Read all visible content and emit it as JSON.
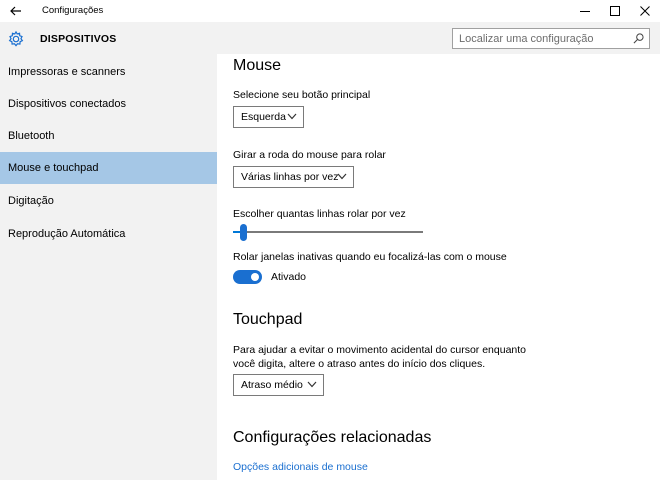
{
  "window": {
    "title": "Configurações"
  },
  "header": {
    "category": "DISPOSITIVOS",
    "search_placeholder": "Localizar uma configuração"
  },
  "sidebar": {
    "items": [
      {
        "label": "Impressoras e scanners",
        "selected": false
      },
      {
        "label": "Dispositivos conectados",
        "selected": false
      },
      {
        "label": "Bluetooth",
        "selected": false
      },
      {
        "label": "Mouse e touchpad",
        "selected": true
      },
      {
        "label": "Digitação",
        "selected": false
      },
      {
        "label": "Reprodução Automática",
        "selected": false
      }
    ]
  },
  "mouse": {
    "heading": "Mouse",
    "primary_button_label": "Selecione seu botão principal",
    "primary_button_value": "Esquerda",
    "scroll_label": "Girar a roda do mouse para rolar",
    "scroll_value": "Várias linhas por vez",
    "lines_label": "Escolher quantas linhas rolar por vez",
    "lines_slider_fraction": 0.04,
    "inactive_label": "Rolar janelas inativas quando eu focalizá-las com o mouse",
    "inactive_state": "Ativado"
  },
  "touchpad": {
    "heading": "Touchpad",
    "description": "Para ajudar a evitar o movimento acidental do cursor enquanto você digita, altere o atraso antes do início dos cliques.",
    "delay_value": "Atraso médio"
  },
  "related": {
    "heading": "Configurações relacionadas",
    "link": "Opções adicionais de mouse"
  },
  "colors": {
    "accent": "#1a6fd0",
    "selected_nav": "#a5c7e6",
    "sidebar_bg": "#f2f2f2"
  },
  "icons": {
    "back": "back-arrow-icon",
    "category": "gear-icon",
    "search": "search-icon"
  }
}
